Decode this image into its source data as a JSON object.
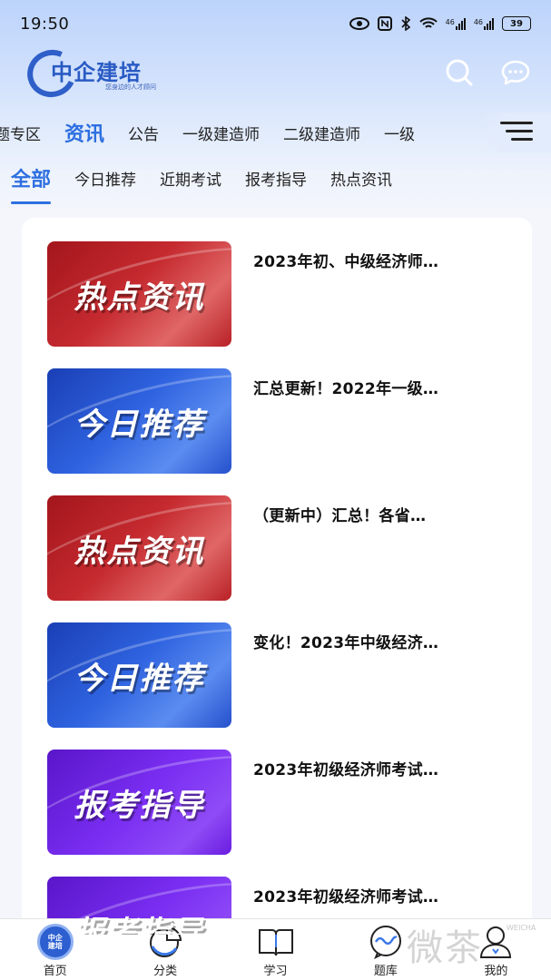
{
  "status_bar": {
    "time": "19:50",
    "network_label_1": "46",
    "network_label_2": "46",
    "battery": "39"
  },
  "header": {
    "logo_text": "中企建培",
    "logo_subtitle": "您身边的人才顾问",
    "icons": [
      "search-icon",
      "message-icon"
    ]
  },
  "category_tabs": [
    {
      "label": "题专区"
    },
    {
      "label": "资讯",
      "active": true
    },
    {
      "label": "公告"
    },
    {
      "label": "一级建造师"
    },
    {
      "label": "二级建造师"
    },
    {
      "label": "一级"
    }
  ],
  "sub_tabs": [
    {
      "label": "全部",
      "active": true
    },
    {
      "label": "今日推荐"
    },
    {
      "label": "近期考试"
    },
    {
      "label": "报考指导"
    },
    {
      "label": "热点资讯"
    }
  ],
  "news": [
    {
      "thumb_text": "热点资讯",
      "thumb_color": "red",
      "title": "2023年初、中级经济师…"
    },
    {
      "thumb_text": "今日推荐",
      "thumb_color": "blue",
      "title": "汇总更新！2022年一级…"
    },
    {
      "thumb_text": "热点资讯",
      "thumb_color": "red",
      "title": "（更新中）汇总！各省…"
    },
    {
      "thumb_text": "今日推荐",
      "thumb_color": "blue",
      "title": "变化！2023年中级经济…"
    },
    {
      "thumb_text": "报考指导",
      "thumb_color": "purple",
      "title": "2023年初级经济师考试…"
    },
    {
      "thumb_text": "报考指导",
      "thumb_color": "purple",
      "title": "2023年初级经济师考试…"
    }
  ],
  "bottom_nav": [
    {
      "label": "首页",
      "icon": "home-logo-icon",
      "badge_text": "中企\n建培",
      "active": true
    },
    {
      "label": "分类",
      "icon": "pie-chart-icon"
    },
    {
      "label": "学习",
      "icon": "book-icon"
    },
    {
      "label": "题库",
      "icon": "wave-bubble-icon"
    },
    {
      "label": "我的",
      "icon": "user-icon"
    }
  ],
  "watermark": {
    "text": "微茶",
    "small": "WEICHA"
  },
  "colors": {
    "accent": "#2d6fe0",
    "red_thumb": "#c52a2f",
    "blue_thumb": "#2f63e0",
    "purple_thumb": "#7a2ef2"
  }
}
